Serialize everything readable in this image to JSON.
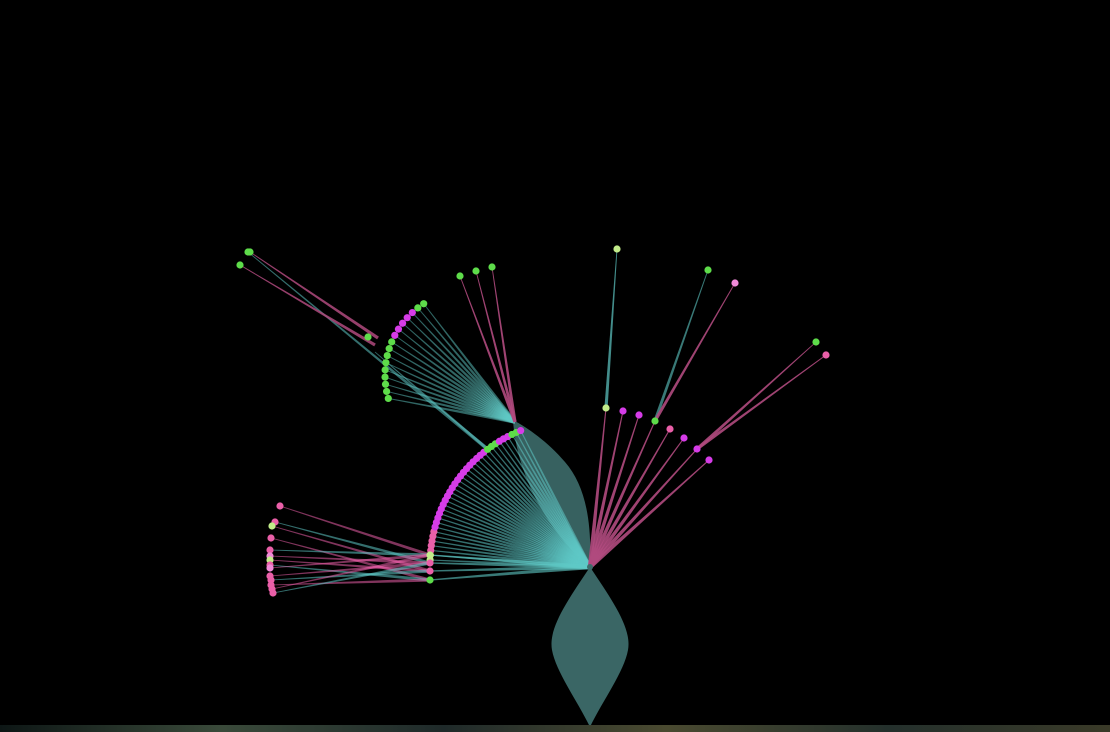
{
  "colors": {
    "background": "#000000",
    "teal_edge": "#5fc9c6",
    "teal_fill": "#3d6b6a",
    "pink_edge": "#b04a7e",
    "node_green": "#5edc4a",
    "node_lightgreen": "#c2ec8a",
    "node_magenta": "#d63ce8",
    "node_pink": "#ea5fa8",
    "node_lightpink": "#f08ad8",
    "bottom_strip": "#2a3a3a"
  },
  "icons": {
    "root": "hub-node-icon",
    "leaf": "leaf-node-icon"
  },
  "tree": {
    "root": "hub",
    "branches": [
      {
        "id": "upper-left-cluster",
        "children": 14,
        "leaf_children": 3
      },
      {
        "id": "upper-arc",
        "children": 36,
        "leaf_children": 3
      },
      {
        "id": "left-cluster",
        "children": 16,
        "leaf_children": 14
      },
      {
        "id": "right-fan",
        "children": 8,
        "leaf_children": 5
      }
    ]
  }
}
